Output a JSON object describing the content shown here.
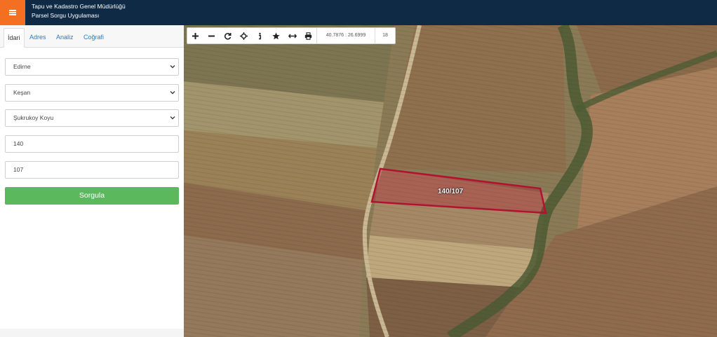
{
  "header": {
    "title": "Tapu ve Kadastro Genel Müdürlüğü",
    "subtitle": "Parsel Sorgu Uygulaması",
    "menu_icon": "hamburger-icon",
    "accent": "#f36f21",
    "bg": "#0e2a45"
  },
  "tabs": [
    {
      "label": "İdari",
      "active": true
    },
    {
      "label": "Adres"
    },
    {
      "label": "Analiz"
    },
    {
      "label": "Coğrafi"
    }
  ],
  "form": {
    "province": "Edirne",
    "district": "Keşan",
    "neighborhood": "Şukrukoy Koyu",
    "block_no": "140",
    "parcel_no": "107",
    "submit_label": "Sorgula",
    "submit_color": "#5cb85c"
  },
  "map": {
    "coordinates": "40.7876 : 26.6999",
    "zoom": "18",
    "parcel_label": "140/107",
    "parcel_color": "#b0122f",
    "tools": [
      "plus-icon",
      "minus-icon",
      "refresh-icon",
      "locate-icon",
      "info-icon",
      "star-icon",
      "measure-icon",
      "print-icon"
    ]
  }
}
